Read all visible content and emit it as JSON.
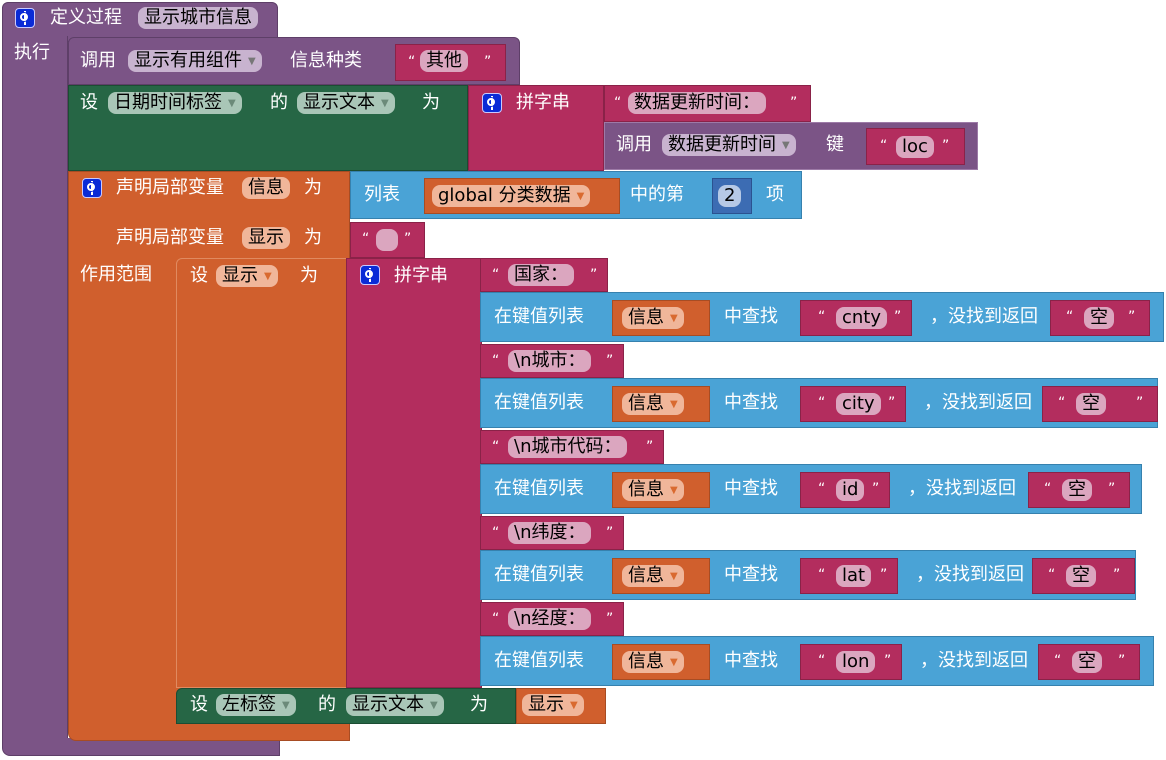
{
  "procedure": {
    "define_label": "定义过程",
    "name": "显示城市信息",
    "do_label": "执行"
  },
  "call_show": {
    "call_label": "调用",
    "proc_name": "显示有用组件",
    "param_label": "信息种类",
    "value": "其他"
  },
  "set_datetime": {
    "set_label": "设",
    "component": "日期时间标签",
    "of_label": "的",
    "property": "显示文本",
    "to_label": "为",
    "join_label": "拼字串",
    "text1": "数据更新时间：",
    "call_label": "调用",
    "call_name": "数据更新时间",
    "key_label": "键",
    "key_value": "loc"
  },
  "local_vars": {
    "declare_label": "声明局部变量",
    "var1": "信息",
    "to_label": "为",
    "list_label": "列表",
    "list_source": "global 分类数据",
    "index_label": "中的第",
    "index_value": "2",
    "item_label": "项",
    "var2": "显示",
    "var2_value": "",
    "scope_label": "作用范围"
  },
  "set_show": {
    "set_label": "设",
    "var": "显示",
    "to_label": "为",
    "join_label": "拼字串"
  },
  "join_items": [
    {
      "text": "国家：",
      "lookup_label": "在键值列表",
      "dict": "信息",
      "find_label": "中查找",
      "key": "cnty",
      "notfound_label": "，没找到返回",
      "default": "空"
    },
    {
      "text": "\\n城市：",
      "lookup_label": "在键值列表",
      "dict": "信息",
      "find_label": "中查找",
      "key": "city",
      "notfound_label": "，没找到返回",
      "default": "空"
    },
    {
      "text": "\\n城市代码：",
      "lookup_label": "在键值列表",
      "dict": "信息",
      "find_label": "中查找",
      "key": "id",
      "notfound_label": "，没找到返回",
      "default": "空"
    },
    {
      "text": "\\n纬度：",
      "lookup_label": "在键值列表",
      "dict": "信息",
      "find_label": "中查找",
      "key": "lat",
      "notfound_label": "，没找到返回",
      "default": "空"
    },
    {
      "text": "\\n经度：",
      "lookup_label": "在键值列表",
      "dict": "信息",
      "find_label": "中查找",
      "key": "lon",
      "notfound_label": "，没找到返回",
      "default": "空"
    }
  ],
  "set_left_label": {
    "set_label": "设",
    "component": "左标签",
    "of_label": "的",
    "property": "显示文本",
    "to_label": "为",
    "value": "显示"
  },
  "quote_open": "“",
  "quote_close": "”",
  "dropdown_glyph": "▼",
  "colors": {
    "procedure": "#7b5486",
    "component_set": "#266645",
    "text": "#b32d5e",
    "list": "#4aa3d6",
    "variable": "#d05f2d",
    "math": "#3c6cb3",
    "mutator_icon": "#0a2bd6"
  }
}
